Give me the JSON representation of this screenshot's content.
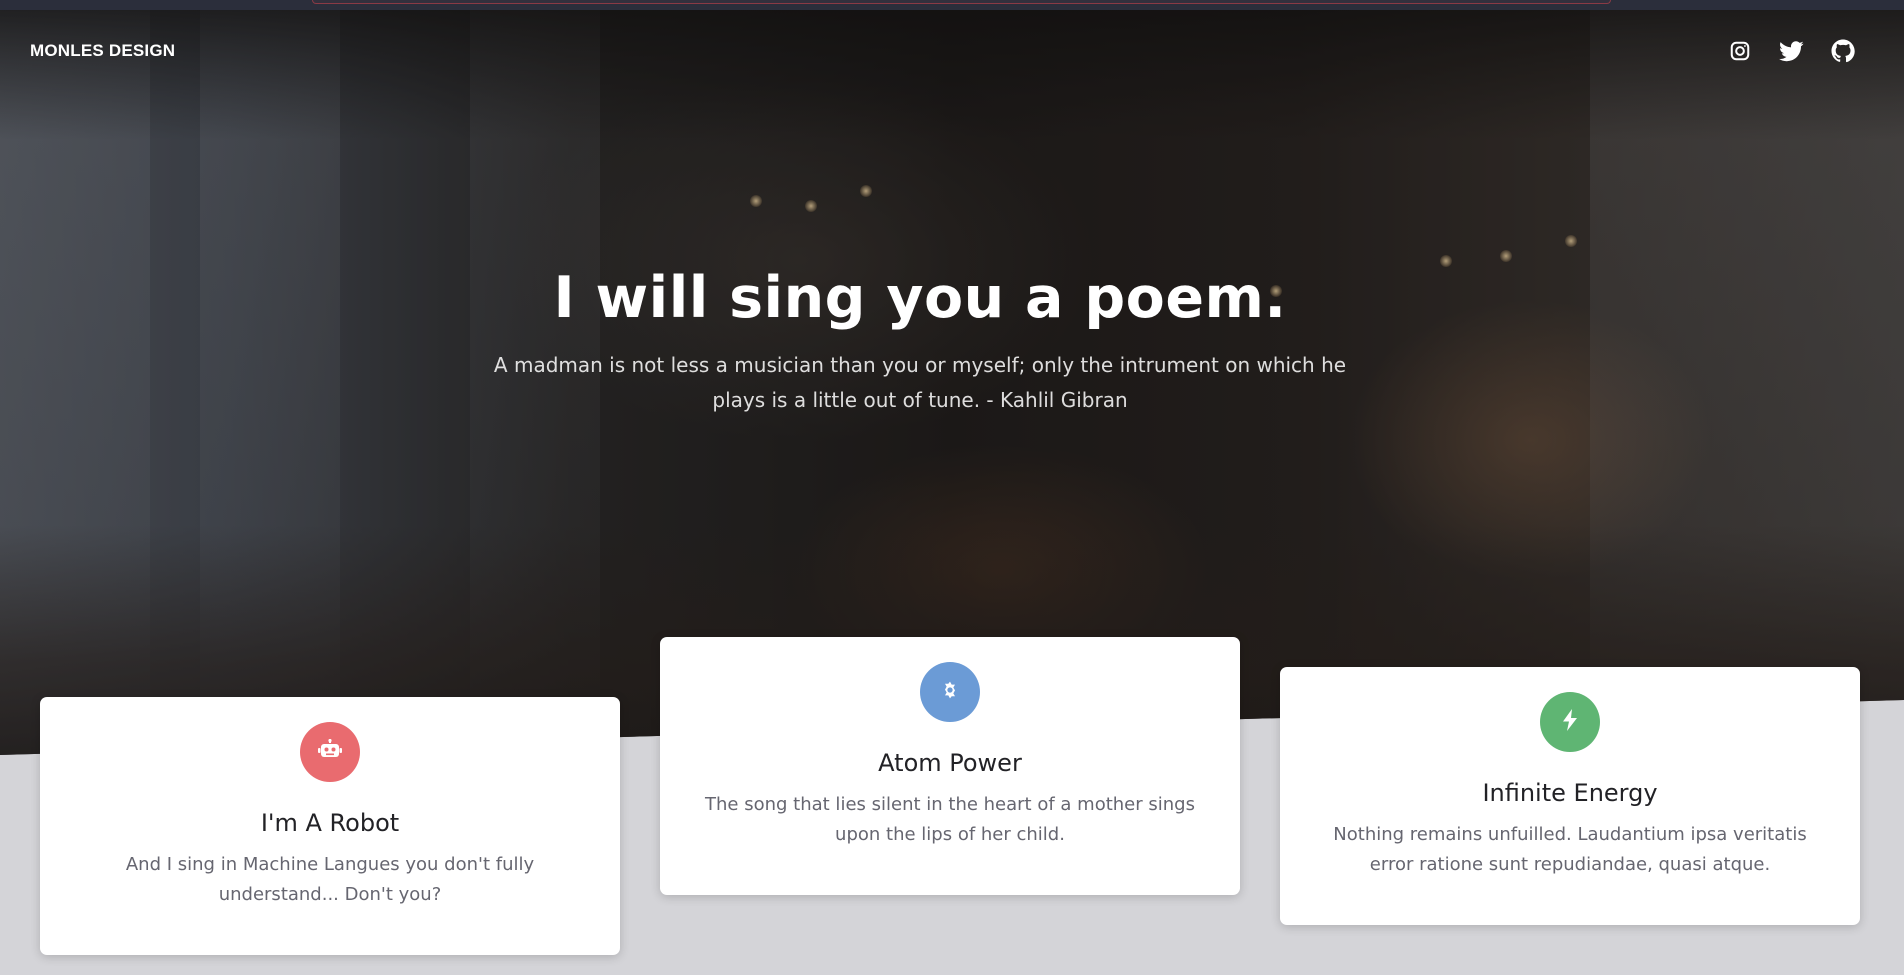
{
  "brand": {
    "name": "MONLES DESIGN"
  },
  "nav": {
    "social": [
      {
        "icon": "instagram-icon",
        "label": "Instagram"
      },
      {
        "icon": "twitter-icon",
        "label": "Twitter"
      },
      {
        "icon": "github-icon",
        "label": "GitHub"
      }
    ]
  },
  "hero": {
    "title": "I will sing you a poem.",
    "subtitle": "A madman is not less a musician than you or myself; only the intrument on which he plays is a little out of tune. - Kahlil Gibran"
  },
  "cards": [
    {
      "icon": "robot-icon",
      "color": "#e96b6f",
      "title": "I'm A Robot",
      "text": "And I sing in Machine Langues you don't fully understand... Don't you?"
    },
    {
      "icon": "atom-icon",
      "color": "#6b9bd6",
      "title": "Atom Power",
      "text": "The song that lies silent in the heart of a mother sings upon the lips of her child."
    },
    {
      "icon": "bolt-icon",
      "color": "#5fb573",
      "title": "Infinite Energy",
      "text": "Nothing remains unfuilled. Laudantium ipsa veritatis error ratione sunt repudiandae, quasi atque."
    }
  ]
}
